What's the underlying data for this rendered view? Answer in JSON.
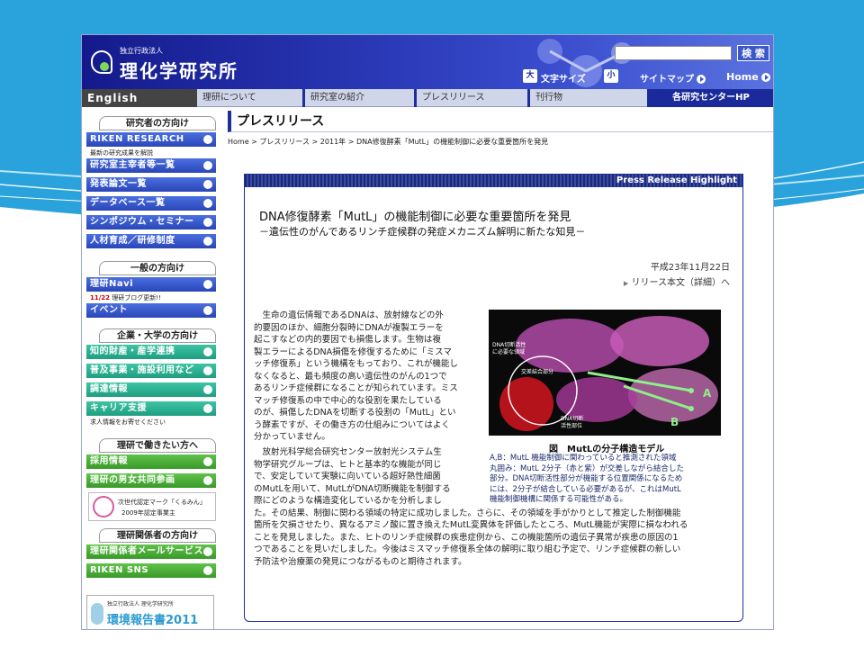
{
  "header": {
    "org_small": "独立行政法人",
    "org_name": "理化学研究所",
    "search_button": "検 索",
    "font_large": "大",
    "font_size_label": "文字サイズ",
    "font_small": "小",
    "sitemap": "サイトマップ",
    "home": "Home"
  },
  "nav": {
    "english": "English",
    "items": [
      "理研について",
      "研究室の紹介",
      "プレスリリース",
      "刊行物"
    ],
    "centers": "各研究センターHP"
  },
  "sidebar": {
    "researchers_header": "研究者の方向け",
    "riken_research": "RIKEN RESEARCH",
    "riken_research_note": "最新の研究成果を解説",
    "researcher_list": "研究室主宰者等一覧",
    "papers": "発表論文一覧",
    "databases": "データベース一覧",
    "symposium": "シンポジウム・セミナー",
    "training": "人材育成／研修制度",
    "general_header": "一般の方向け",
    "riken_navi": "理研Navi",
    "navi_note_date": "11/22",
    "navi_note": "理研ブログ更新!!",
    "events": "イベント",
    "company_header": "企業・大学の方向け",
    "ip": "知的財産・産学連携",
    "outreach": "普及事業・施設利用など",
    "procurement": "調達情報",
    "career": "キャリア支援",
    "career_note": "求人情報をお寄せください",
    "work_header": "理研で働きたい方へ",
    "recruit": "採用情報",
    "equality": "理研の男女共同参画",
    "kurumin_line1": "次世代認定マーク「くるみん」",
    "kurumin_line2": "2009年認定事業主",
    "related_header": "理研関係者の方向け",
    "mail_service": "理研関係者メールサービス",
    "sns": "RIKEN SNS",
    "eco_small": "独立行政法人 理化学研究所",
    "eco_title": "環境報告書2011"
  },
  "main": {
    "page_title": "プレスリリース",
    "breadcrumb": "Home > プレスリリース > 2011年 > DNA修復酵素「MutL」の機能制御に必要な重要箇所を発見",
    "highlight_label": "Press Release Highlight",
    "title": "DNA修復酵素「MutL」の機能制御に必要な重要箇所を発見",
    "subtitle": "－遺伝性のがんであるリンチ症候群の発症メカニズム解明に新たな知見－",
    "date": "平成23年11月22日",
    "release_link": "リリース本文（詳細）へ",
    "para1": [
      "　生命の遺伝情報であるDNAは、放射線などの外",
      "的要因のほか、細胞分裂時にDNAが複製エラーを",
      "起こすなどの内的要因でも損傷します。生物は複",
      "製エラーによるDNA損傷を修復するために「ミスマ",
      "ッチ修復系」という機構をもっており、これが機能し",
      "なくなると、最も頻度の高い遺伝性のがんの1つで",
      "あるリンチ症候群になることが知られています。ミス",
      "マッチ修復系の中で中心的な役割を果たしている",
      "のが、損傷したDNAを切断する役割の「MutL」とい",
      "う酵素ですが、その働き方の仕組みについてはよく",
      "分かっていません。"
    ],
    "para2": [
      "　放射光科学総合研究センター放射光システム生",
      "物学研究グループは、ヒトと基本的な機能が同じ",
      "で、安定していて実験に向いている超好熱性細菌",
      "のMutLを用いて、MutLがDNA切断機能を制御する",
      "際にどのような構造変化しているかを分析しまし",
      "た。その結果、制御に関わる領域の特定に成功しました。さらに、その領域を手がかりとして推定した制御機能",
      "箇所を欠損させたり、異なるアミノ酸に置き換えたMutL変異体を評価したところ、MutL機能が実際に損なわれる",
      "ことを発見しました。また、ヒトのリンチ症候群の疾患症例から、この機能箇所の遺伝子異常が疾患の原因の1",
      "つであることを見いだしました。今後はミスマッチ修復系全体の解明に取り組む予定で、リンチ症候群の新しい",
      "予防法や治療薬の発見につながるものと期待されます。"
    ],
    "figure": {
      "label_a": "A",
      "label_b": "B",
      "label_dna": "DNA切断活性",
      "label_dna2": "に必要な領域",
      "label_cross": "交差結合部分",
      "label_active": "DNA切断",
      "label_active2": "活性部位",
      "caption": "図　MutLの分子構造モデル",
      "desc": [
        "A,B：MutL 機能制御に関わっていると推測された領域",
        "丸囲み：MutL 2分子（赤と紫）が交差しながら結合した",
        "部分。DNA切断活性部分が機能する位置関係になるため",
        "には、2分子が結合している必要があるが、これはMutL",
        "機能制御機構に関係する可能性がある。"
      ]
    }
  }
}
